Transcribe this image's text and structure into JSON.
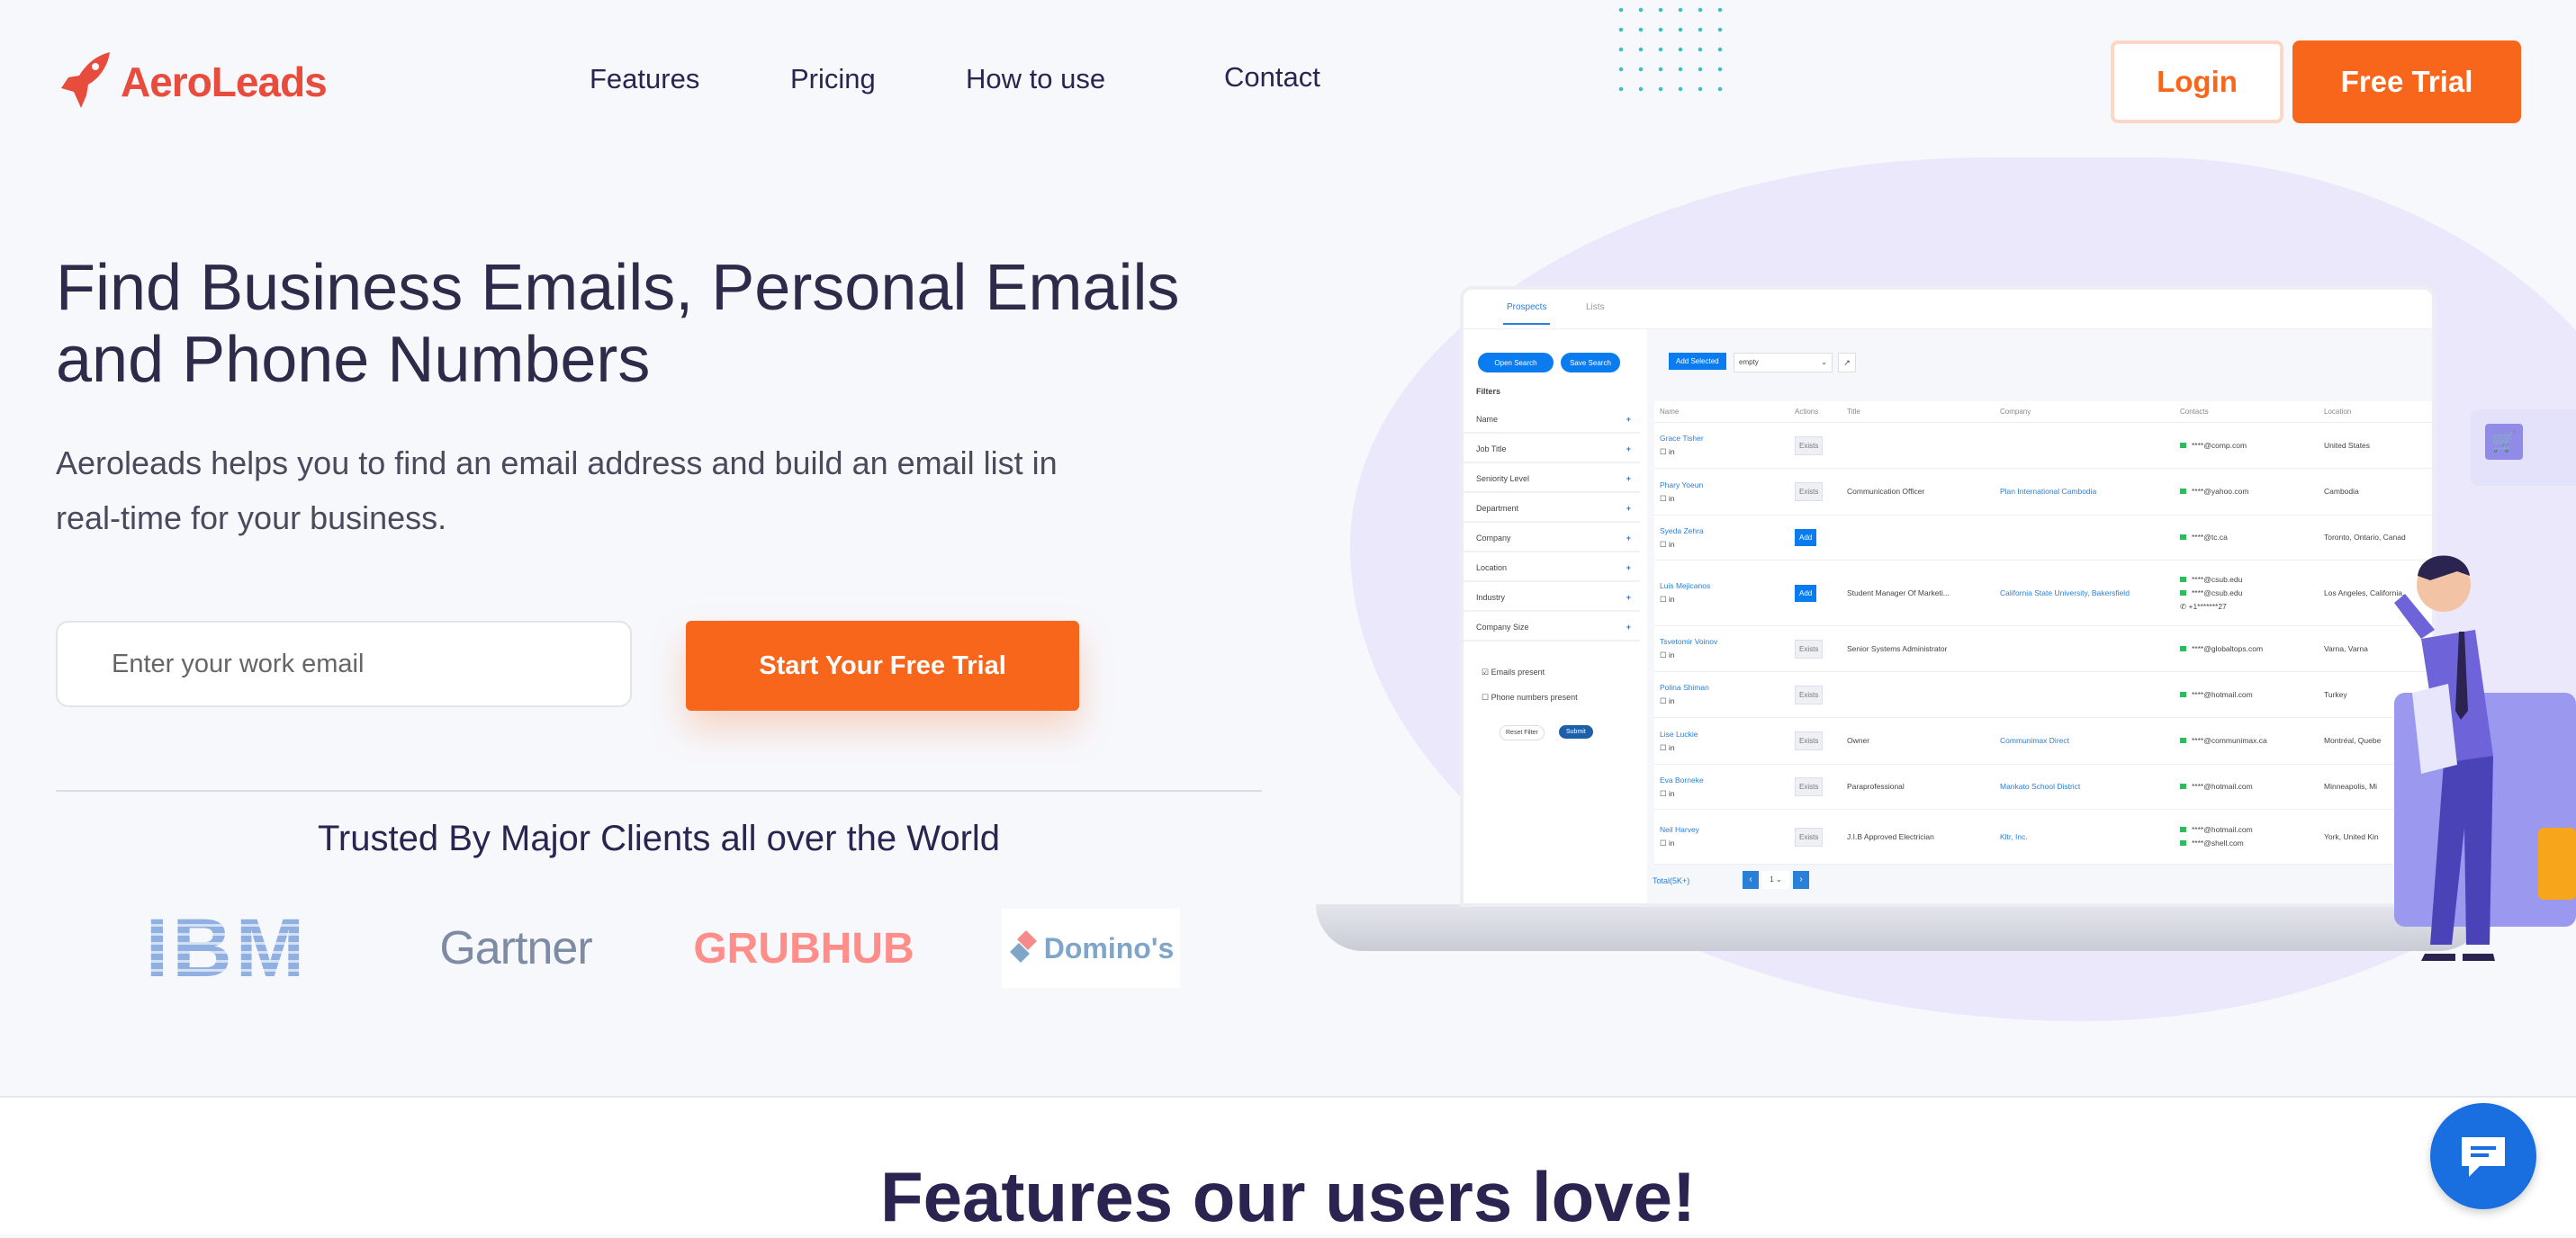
{
  "header": {
    "brand": "AeroLeads",
    "nav": [
      "Features",
      "Pricing",
      "How to use",
      "Contact"
    ],
    "login_label": "Login",
    "free_trial_label": "Free Trial"
  },
  "hero": {
    "headline_line1": "Find Business Emails, Personal Emails",
    "headline_line2": "and Phone Numbers",
    "subtitle_line1": "Aeroleads helps you to find an email address and build an email list in",
    "subtitle_line2": "real-time for your business.",
    "email_placeholder": "Enter your work email",
    "cta_label": "Start Your Free Trial",
    "trusted_text": "Trusted By Major Clients all over the World",
    "clients": [
      "IBM",
      "Gartner",
      "GRUBHUB",
      "Domino's"
    ]
  },
  "app_preview": {
    "tabs": [
      "Prospects",
      "Lists"
    ],
    "open_search": "Open Search",
    "save_search": "Save Search",
    "filters_title": "Filters",
    "filters": [
      "Name",
      "Job Title",
      "Seniority Level",
      "Department",
      "Company",
      "Location",
      "Industry",
      "Company Size"
    ],
    "emails_present": "Emails present",
    "phone_present": "Phone numbers present",
    "reset_filter": "Reset Filter",
    "submit": "Submit",
    "add_selected": "Add Selected",
    "list_select": "empty",
    "columns": [
      "Name",
      "Actions",
      "Title",
      "Company",
      "Contacts",
      "Location"
    ],
    "rows": [
      {
        "name": "Grace Tisher",
        "action": "Exists",
        "title": "",
        "company": "",
        "contacts": [
          "****@comp.com"
        ],
        "location": "United States"
      },
      {
        "name": "Phary Yoeun",
        "action": "Exists",
        "title": "Communication Officer",
        "company": "Plan International Cambodia",
        "contacts": [
          "****@yahoo.com"
        ],
        "location": "Cambodia"
      },
      {
        "name": "Syeda Zehra",
        "action": "Add",
        "title": "",
        "company": "",
        "contacts": [
          "****@tc.ca"
        ],
        "location": "Toronto, Ontario, Canad"
      },
      {
        "name": "Luis Mejicanos",
        "action": "Add",
        "title": "Student Manager Of Marketi...",
        "company": "California State University, Bakersfield",
        "contacts": [
          "****@csub.edu",
          "****@csub.edu",
          "+1*******27"
        ],
        "location": "Los Angeles, California,"
      },
      {
        "name": "Tsvetomir Voinov",
        "action": "Exists",
        "title": "Senior Systems Administrator",
        "company": "",
        "contacts": [
          "****@globaltops.com"
        ],
        "location": "Varna, Varna"
      },
      {
        "name": "Polina Shiman",
        "action": "Exists",
        "title": "",
        "company": "",
        "contacts": [
          "****@hotmail.com"
        ],
        "location": "Turkey"
      },
      {
        "name": "Lise Luckie",
        "action": "Exists",
        "title": "Owner",
        "company": "Communimax Direct",
        "contacts": [
          "****@communimax.ca"
        ],
        "location": "Montréal, Quebe"
      },
      {
        "name": "Eva Borneke",
        "action": "Exists",
        "title": "Paraprofessional",
        "company": "Mankato School District",
        "contacts": [
          "****@hotmail.com"
        ],
        "location": "Minneapolis, Mi"
      },
      {
        "name": "Neil Harvey",
        "action": "Exists",
        "title": "J.I.B Approved Electrician",
        "company": "Kltr, Inc.",
        "contacts": [
          "****@hotmail.com",
          "****@shell.com"
        ],
        "location": "York, United Kin"
      }
    ],
    "total": "Total(5K+)",
    "page": "1"
  },
  "features_heading": "Features our users love!",
  "colors": {
    "brand": "#e84c3d",
    "accent": "#f7661a",
    "navy": "#2b2350",
    "app_blue": "#0a7cf0",
    "chat": "#1a6fe0"
  }
}
